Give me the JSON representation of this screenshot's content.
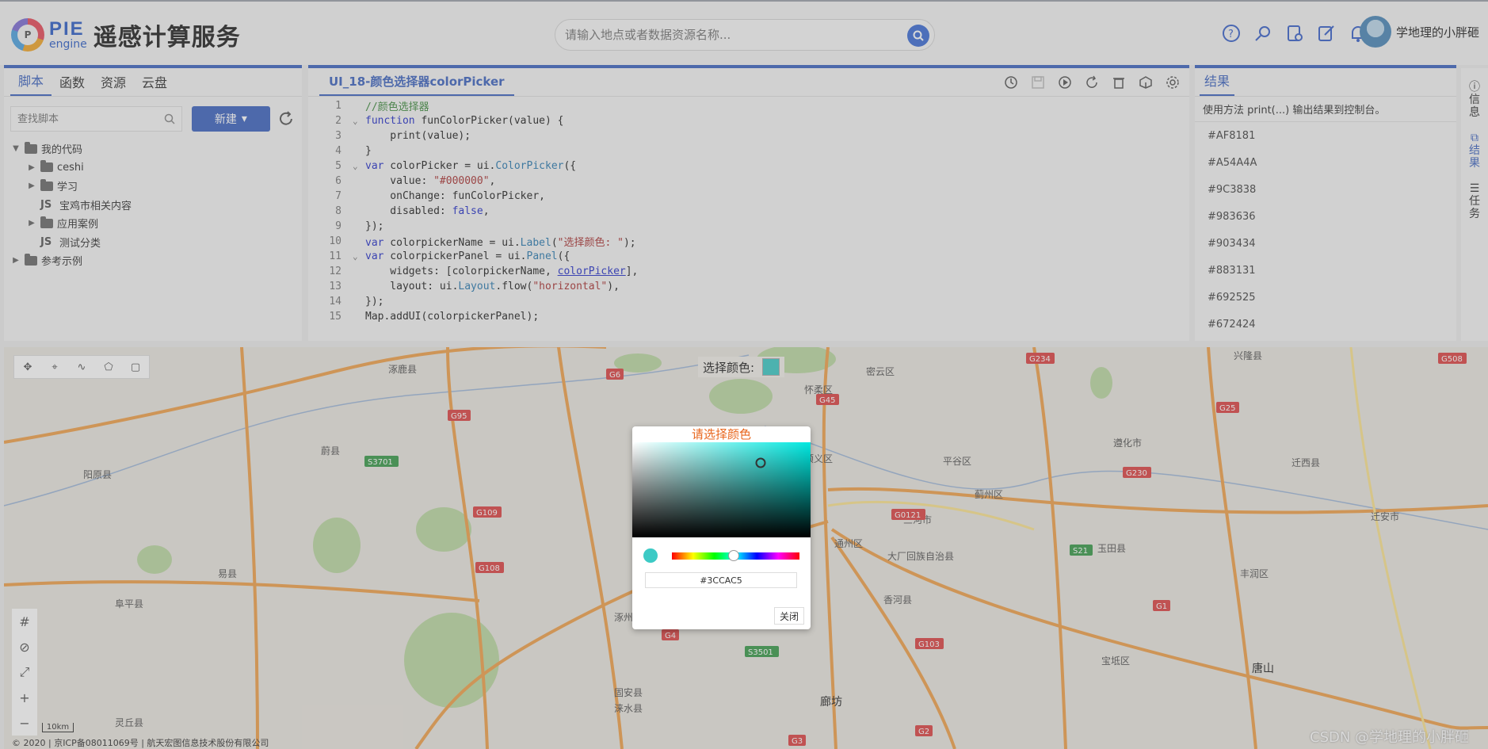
{
  "header": {
    "logo_pie": "PIE",
    "logo_engine": "engine",
    "logo_mark": "P",
    "brand": "遥感计算服务",
    "search_placeholder": "请输入地点或者数据资源名称...",
    "user_name": "学地理的小胖砸",
    "icons": [
      "help-icon",
      "search-rocket-icon",
      "document-icon",
      "edit-icon",
      "bell-icon"
    ]
  },
  "left_panel": {
    "tabs": [
      "脚本",
      "函数",
      "资源",
      "云盘"
    ],
    "active_tab": 0,
    "search_placeholder": "查找脚本",
    "new_button": "新建",
    "tree": [
      {
        "type": "folder",
        "label": "我的代码",
        "depth": 0,
        "expanded": true
      },
      {
        "type": "folder",
        "label": "ceshi",
        "depth": 1,
        "expanded": false
      },
      {
        "type": "folder",
        "label": "学习",
        "depth": 1,
        "expanded": false
      },
      {
        "type": "file",
        "label": "宝鸡市相关内容",
        "depth": 1
      },
      {
        "type": "folder",
        "label": "应用案例",
        "depth": 1,
        "expanded": false
      },
      {
        "type": "file",
        "label": "测试分类",
        "depth": 1
      },
      {
        "type": "folder",
        "label": "参考示例",
        "depth": 0,
        "expanded": false
      }
    ]
  },
  "editor": {
    "title": "UI_18-颜色选择器colorPicker",
    "lines": [
      {
        "n": "1",
        "fold": "",
        "html": "<span class='cmt'>//颜色选择器</span>"
      },
      {
        "n": "2",
        "fold": "v",
        "html": "<span class='kw'>function</span> funColorPicker(value) {"
      },
      {
        "n": "3",
        "fold": "",
        "html": "    print(value);"
      },
      {
        "n": "4",
        "fold": "",
        "html": "}"
      },
      {
        "n": "5",
        "fold": "v",
        "html": "<span class='kw'>var</span> colorPicker = ui.<span class='fn'>ColorPicker</span>({"
      },
      {
        "n": "6",
        "fold": "",
        "html": "    value: <span class='str'>\"#000000\"</span>,"
      },
      {
        "n": "7",
        "fold": "",
        "html": "    onChange: funColorPicker,"
      },
      {
        "n": "8",
        "fold": "",
        "html": "    disabled: <span class='lit'>false</span>,"
      },
      {
        "n": "9",
        "fold": "",
        "html": "});"
      },
      {
        "n": "10",
        "fold": "",
        "html": "<span class='kw'>var</span> colorpickerName = ui.<span class='fn'>Label</span>(<span class='str'>\"选择颜色: \"</span>);"
      },
      {
        "n": "11",
        "fold": "v",
        "html": "<span class='kw'>var</span> colorpickerPanel = ui.<span class='fn'>Panel</span>({"
      },
      {
        "n": "12",
        "fold": "",
        "html": "    widgets: [colorpickerName, <span class='kw' style='text-decoration:underline'>colorPicker</span>],"
      },
      {
        "n": "13",
        "fold": "",
        "html": "    layout: ui.<span class='fn'>Layout</span>.flow(<span class='str'>\"horizontal\"</span>),"
      },
      {
        "n": "14",
        "fold": "",
        "html": "});"
      },
      {
        "n": "15",
        "fold": "",
        "html": "Map.addUI(colorpickerPanel);"
      }
    ]
  },
  "results": {
    "tab": "结果",
    "hint": "使用方法 print(...) 输出结果到控制台。",
    "items": [
      "#AF8181",
      "#A54A4A",
      "#9C3838",
      "#983636",
      "#903434",
      "#883131",
      "#692525",
      "#672424"
    ]
  },
  "right_rail": [
    {
      "label": "信\n息",
      "icon": "info-icon",
      "active": false
    },
    {
      "label": "结\n果",
      "icon": "results-icon",
      "active": true
    },
    {
      "label": "任\n务",
      "icon": "task-icon",
      "active": false
    }
  ],
  "map": {
    "color_label": "选择颜色:",
    "selected_color": "#3CCAC5",
    "scale": "10km",
    "copyright": "© 2020 | 京ICP备08011069号 | 航天宏图信息技术股份有限公司",
    "watermark": "CSDN @学地理的小胖砸",
    "places": [
      "涿鹿县",
      "怀柔区",
      "兴隆县",
      "密云区",
      "顺义区",
      "平谷区",
      "通州区",
      "廊坊",
      "唐山",
      "三河市",
      "宝坻区",
      "玉田县",
      "遵化市",
      "迁西县",
      "迁安市",
      "香河县",
      "大厂回族自治县",
      "固安县",
      "涿州市",
      "易县",
      "阜平县",
      "涞水县",
      "丰润区",
      "蓟州区",
      "阳原县",
      "蔚县",
      "灵丘县"
    ],
    "shields": [
      "G6",
      "G95",
      "S3701",
      "G109",
      "G108",
      "G4",
      "S3501",
      "G3",
      "G45",
      "G0121",
      "G1",
      "G25",
      "S21",
      "G230",
      "G234",
      "G508",
      "G2",
      "G103"
    ]
  },
  "color_picker": {
    "title": "请选择颜色",
    "hex_value": "#3CCAC5",
    "close_label": "关闭",
    "hue_pct": 48.5,
    "sat_pct": 72,
    "bright_pct": 22
  }
}
